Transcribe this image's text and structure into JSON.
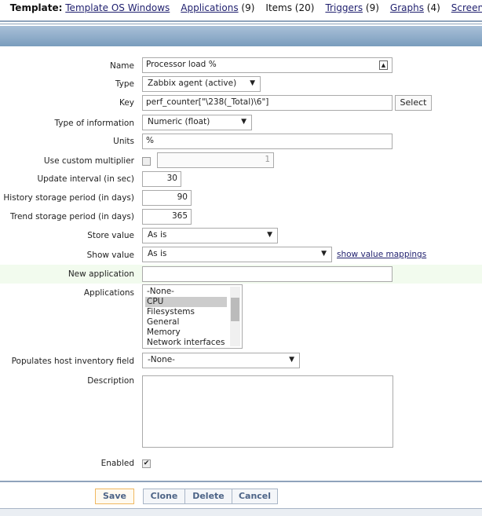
{
  "nav": {
    "template_label": "Template:",
    "template_name": "Template OS Windows",
    "applications": "Applications",
    "applications_count": "(9)",
    "items": "Items (20)",
    "triggers": "Triggers",
    "triggers_count": "(9)",
    "graphs": "Graphs",
    "graphs_count": "(4)",
    "screens": "Screens"
  },
  "form": {
    "name_label": "Name",
    "name_value": "Processor load %",
    "type_label": "Type",
    "type_value": "Zabbix agent (active)",
    "key_label": "Key",
    "key_value": "perf_counter[\"\\238(_Total)\\6\"]",
    "select_label": "Select",
    "type_info_label": "Type of information",
    "type_info_value": "Numeric (float)",
    "units_label": "Units",
    "units_value": "%",
    "multiplier_label": "Use custom multiplier",
    "multiplier_value": "1",
    "update_label": "Update interval (in sec)",
    "update_value": "30",
    "history_label": "History storage period (in days)",
    "history_value": "90",
    "trend_label": "Trend storage period (in days)",
    "trend_value": "365",
    "store_label": "Store value",
    "store_value": "As is",
    "show_label": "Show value",
    "show_value": "As is",
    "show_mappings_link": "show value mappings",
    "new_app_label": "New application",
    "new_app_value": "",
    "applications_label": "Applications",
    "applications": [
      "-None-",
      "CPU",
      "Filesystems",
      "General",
      "Memory",
      "Network interfaces"
    ],
    "inventory_label": "Populates host inventory field",
    "inventory_value": "-None-",
    "description_label": "Description",
    "description_value": "",
    "enabled_label": "Enabled"
  },
  "buttons": {
    "save": "Save",
    "clone": "Clone",
    "delete": "Delete",
    "cancel": "Cancel"
  }
}
